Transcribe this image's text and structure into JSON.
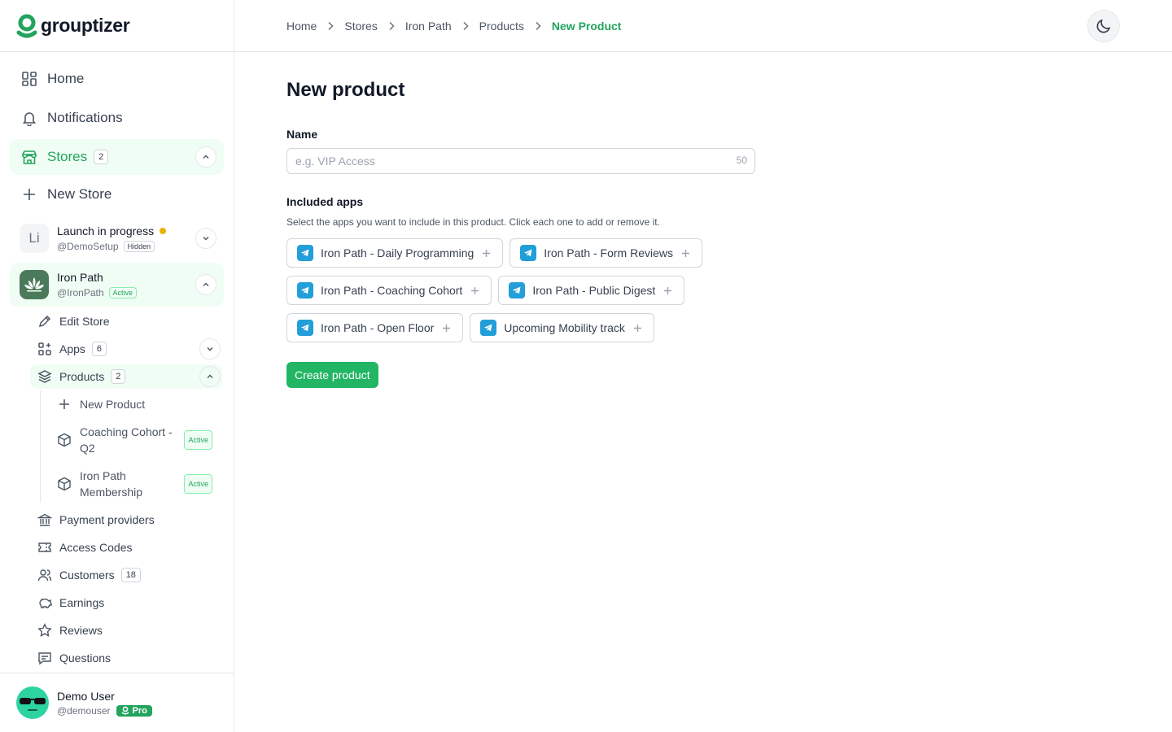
{
  "brand": {
    "name": "grouptizer",
    "accent": "#22a45d"
  },
  "nav": {
    "home": "Home",
    "notifications": "Notifications",
    "stores": "Stores",
    "stores_count": "2",
    "new_store": "New Store"
  },
  "stores": [
    {
      "initials": "Li",
      "name": "Launch in progress",
      "handle": "@DemoSetup",
      "status": "Hidden"
    },
    {
      "name": "Iron Path",
      "handle": "@IronPath",
      "status": "Active"
    }
  ],
  "store_menu": {
    "edit_store": "Edit Store",
    "apps": "Apps",
    "apps_count": "6",
    "products": "Products",
    "products_count": "2",
    "new_product": "New Product",
    "product_items": [
      {
        "name": "Coaching Cohort - Q2",
        "status": "Active"
      },
      {
        "name": "Iron Path Membership",
        "status": "Active"
      }
    ],
    "payment_providers": "Payment providers",
    "access_codes": "Access Codes",
    "customers": "Customers",
    "customers_count": "18",
    "earnings": "Earnings",
    "reviews": "Reviews",
    "questions": "Questions"
  },
  "user": {
    "name": "Demo User",
    "handle": "@demouser",
    "plan": "Pro"
  },
  "breadcrumb": [
    "Home",
    "Stores",
    "Iron Path",
    "Products",
    "New Product"
  ],
  "form": {
    "title": "New product",
    "name_label": "Name",
    "name_placeholder": "e.g. VIP Access",
    "name_value": "",
    "name_max": "50",
    "apps_label": "Included apps",
    "apps_help": "Select the apps you want to include in this product. Click each one to add or remove it.",
    "apps": [
      "Iron Path - Daily Programming",
      "Iron Path - Form Reviews",
      "Iron Path - Coaching Cohort",
      "Iron Path - Public Digest",
      "Iron Path - Open Floor",
      "Upcoming Mobility track"
    ],
    "submit_label": "Create product"
  }
}
